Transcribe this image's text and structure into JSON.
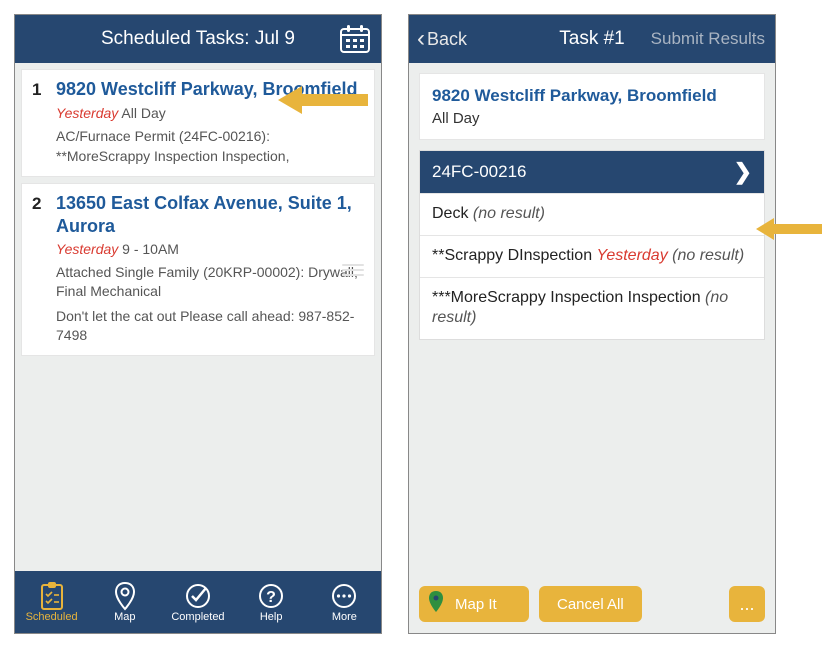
{
  "left_screen": {
    "title": "Scheduled Tasks: Jul 9",
    "tasks": [
      {
        "num": "1",
        "address": "9820 Westcliff Parkway, Broomfield",
        "when_prefix": "Yesterday",
        "when_rest": " All Day",
        "line1": "AC/Furnace Permit (24FC-00216):",
        "line2": "**MoreScrappy Inspection Inspection,"
      },
      {
        "num": "2",
        "address": "13650 East Colfax Avenue, Suite 1, Aurora",
        "when_prefix": "Yesterday",
        "when_rest": " 9 - 10AM",
        "line1": "Attached Single Family (20KRP-00002): Drywall, Final Mechanical",
        "line2": "Don't let the cat out Please call ahead: 987-852-7498"
      }
    ],
    "tabs": {
      "scheduled": "Scheduled",
      "map": "Map",
      "completed": "Completed",
      "help": "Help",
      "more": "More"
    }
  },
  "right_screen": {
    "back": "Back",
    "title": "Task #1",
    "submit": "Submit Results",
    "address": "9820 Westcliff Parkway, Broomfield",
    "allday": "All Day",
    "section": "24FC-00216",
    "rows": {
      "r1_label": "Deck ",
      "r1_result": "(no result)",
      "r2_label": "**Scrappy DInspection ",
      "r2_yest": "Yesterday",
      "r2_result": "  (no result)",
      "r3_label": "***MoreScrappy Inspection Inspection ",
      "r3_result": "(no result)"
    },
    "actions": {
      "mapit": "Map It",
      "cancel": "Cancel All",
      "more": "..."
    }
  }
}
